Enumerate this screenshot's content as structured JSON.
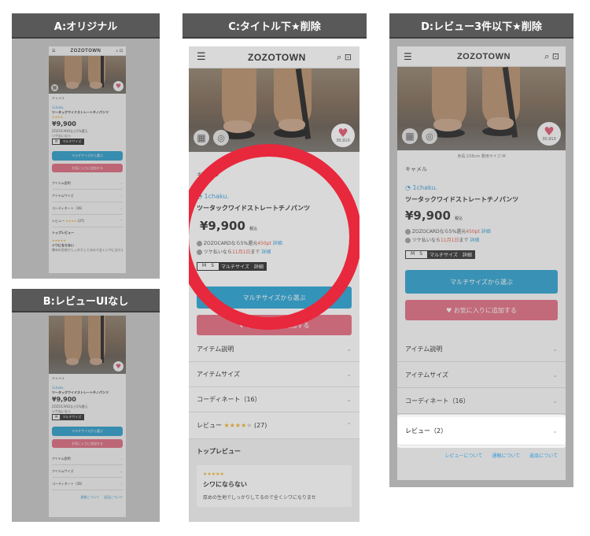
{
  "labels": {
    "a": "A:オリジナル",
    "b": "B:レビューUIなし",
    "c": "C:タイトル下★削除",
    "d": "D:レビュー3件以下★削除"
  },
  "app": {
    "logo": "ZOZOTOWN",
    "like_count": "30,910",
    "photo_caption": "身長:158cm 着用サイズ:M"
  },
  "product": {
    "category": "キャメル",
    "brand": "1chaku.",
    "name": "ツータックワイドストレートチノパンツ",
    "price": "¥9,900",
    "tax": "税込",
    "zozocard_line": "ZOZOCARDなら5%還元",
    "zozocard_points": "450pt",
    "detail": "詳細",
    "tsuke_line_prefix": "ツケ払いなら",
    "tsuke_line_date": "11月1日",
    "tsuke_line_suffix": "まで",
    "size_m": "M",
    "size_s": "S",
    "multi_size_tag": "マルチサイズ",
    "detail_tag": "詳細"
  },
  "buttons": {
    "multi_size": "マルチサイズから選ぶ",
    "favorite": "お気に入りに追加する"
  },
  "accordion": {
    "item_desc": "アイテム説明",
    "item_size": "アイテムサイズ",
    "coordinate": "コーディネート（16）",
    "review": "レビュー",
    "review_count": "(27)",
    "review_count_d": "レビュー（2）"
  },
  "review": {
    "top_title": "トップレビュー",
    "stars": "★★★★★",
    "rating_stars": "★★★★",
    "rating_empty": "★",
    "headline": "シワにならない",
    "body": "厚めの生地でしっかりしてるので全くシワになりませ"
  },
  "footer_links": {
    "about_reviews": "レビューについて",
    "about_reports": "通報について",
    "about_returns": "返品について"
  }
}
